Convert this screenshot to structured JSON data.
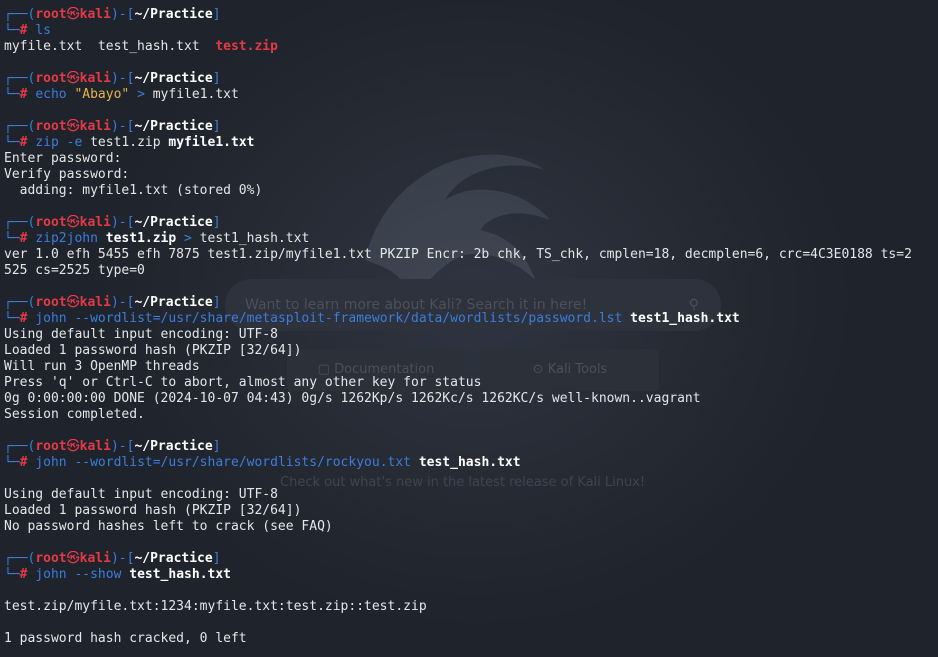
{
  "prompt": {
    "user": "root",
    "symbol": "㉿",
    "host": "kali",
    "path": "~/Practice",
    "hash": "#"
  },
  "background": {
    "search_placeholder": "Want to learn more about Kali? Search it in here!",
    "search_icon": "search-icon",
    "doc_button": "Documentation",
    "tools_button": "Kali Tools",
    "news": "Check out what's new in the latest release of Kali Linux!"
  },
  "blocks": [
    {
      "cmd": [
        "ls"
      ],
      "output": [
        {
          "parts": [
            "myfile.txt  test_hash.txt  ",
            "test.zip"
          ]
        }
      ]
    },
    {
      "cmd": [
        "echo ",
        "\"Abayo\"",
        " > ",
        "myfile1.txt"
      ],
      "output": []
    },
    {
      "cmd": [
        "zip ",
        "-e ",
        "test1.zip ",
        "myfile1.txt"
      ],
      "output": [
        {
          "text": "Enter password:"
        },
        {
          "text": "Verify password:"
        },
        {
          "text": "  adding: myfile1.txt (stored 0%)"
        }
      ]
    },
    {
      "cmd": [
        "zip2john ",
        "test1.zip",
        " > ",
        "test1_hash.txt"
      ],
      "output": [
        {
          "text": "ver 1.0 efh 5455 efh 7875 test1.zip/myfile1.txt PKZIP Encr: 2b chk, TS_chk, cmplen=18, decmplen=6, crc=4C3E0188 ts=2"
        },
        {
          "text": "525 cs=2525 type=0"
        }
      ]
    },
    {
      "cmd": [
        "john ",
        "--wordlist=/usr/share/metasploit-framework/data/wordlists/password.lst ",
        "test1_hash.txt"
      ],
      "output": [
        {
          "text": "Using default input encoding: UTF-8"
        },
        {
          "text": "Loaded 1 password hash (PKZIP [32/64])"
        },
        {
          "text": "Will run 3 OpenMP threads"
        },
        {
          "text": "Press 'q' or Ctrl-C to abort, almost any other key for status"
        },
        {
          "text": "0g 0:00:00:00 DONE (2024-10-07 04:43) 0g/s 1262Kp/s 1262Kc/s 1262KC/s well-known..vagrant"
        },
        {
          "text": "Session completed."
        }
      ]
    },
    {
      "cmd": [
        "john ",
        "--wordlist=/usr/share/wordlists/rockyou.txt ",
        "test_hash.txt"
      ],
      "output": [
        {
          "text": ""
        },
        {
          "text": "Using default input encoding: UTF-8"
        },
        {
          "text": "Loaded 1 password hash (PKZIP [32/64])"
        },
        {
          "text": "No password hashes left to crack (see FAQ)"
        }
      ]
    },
    {
      "cmd": [
        "john ",
        "--show ",
        "test_hash.txt"
      ],
      "output": [
        {
          "text": ""
        },
        {
          "text": "test.zip/myfile.txt:1234:myfile.txt:test.zip::test.zip"
        },
        {
          "text": ""
        },
        {
          "text": "1 password hash cracked, 0 left"
        }
      ]
    }
  ]
}
